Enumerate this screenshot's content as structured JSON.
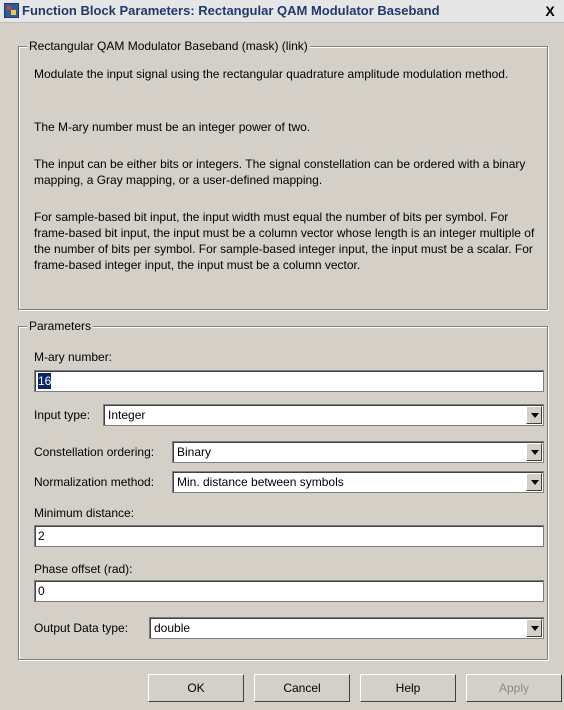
{
  "window": {
    "title": "Function Block Parameters: Rectangular QAM Modulator Baseband",
    "close_label": "X"
  },
  "mask_group": {
    "legend": "Rectangular QAM Modulator Baseband (mask) (link)",
    "paragraphs": [
      "Modulate the input signal using the rectangular quadrature amplitude modulation method.",
      "The M-ary number must be an integer power of two.",
      "The input can be either bits or integers. The signal constellation can be ordered with a binary mapping, a Gray mapping, or a user-defined mapping.",
      "For sample-based bit input, the input width must equal the number of bits per symbol. For frame-based bit input, the input must be a column vector whose length is an integer multiple of the number of bits per symbol. For sample-based integer input, the input must be a scalar. For frame-based integer input, the input must be a column vector."
    ]
  },
  "parameters": {
    "legend": "Parameters",
    "mary_label": "M-ary number:",
    "mary_value": "16",
    "input_type_label": "Input type:",
    "input_type_value": "Integer",
    "constellation_label": "Constellation ordering:",
    "constellation_value": "Binary",
    "normalization_label": "Normalization method:",
    "normalization_value": "Min. distance between symbols",
    "min_distance_label": "Minimum distance:",
    "min_distance_value": "2",
    "phase_offset_label": "Phase offset (rad):",
    "phase_offset_value": "0",
    "output_type_label": "Output Data type:",
    "output_type_value": "double"
  },
  "buttons": {
    "ok": "OK",
    "cancel": "Cancel",
    "help": "Help",
    "apply": "Apply"
  }
}
